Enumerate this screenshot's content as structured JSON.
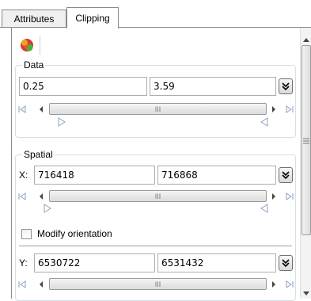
{
  "tabs": [
    {
      "label": "Attributes",
      "active": false
    },
    {
      "label": "Clipping",
      "active": true
    }
  ],
  "toolbar": {
    "icon": "colormap-icon"
  },
  "data_group": {
    "title": "Data",
    "min_value": "0.25",
    "max_value": "3.59"
  },
  "spatial_group": {
    "title": "Spatial",
    "x_label": "X:",
    "x_min": "716418",
    "x_max": "716868",
    "modify_orientation_label": "Modify orientation",
    "modify_orientation_checked": false,
    "y_label": "Y:",
    "y_min": "6530722",
    "y_max": "6531432"
  },
  "scroll_thumb_grip": "III",
  "colors": {
    "accent_icon_red": "#d9382c",
    "accent_icon_green": "#4caf3c",
    "group_border": "#d5dfe5"
  }
}
